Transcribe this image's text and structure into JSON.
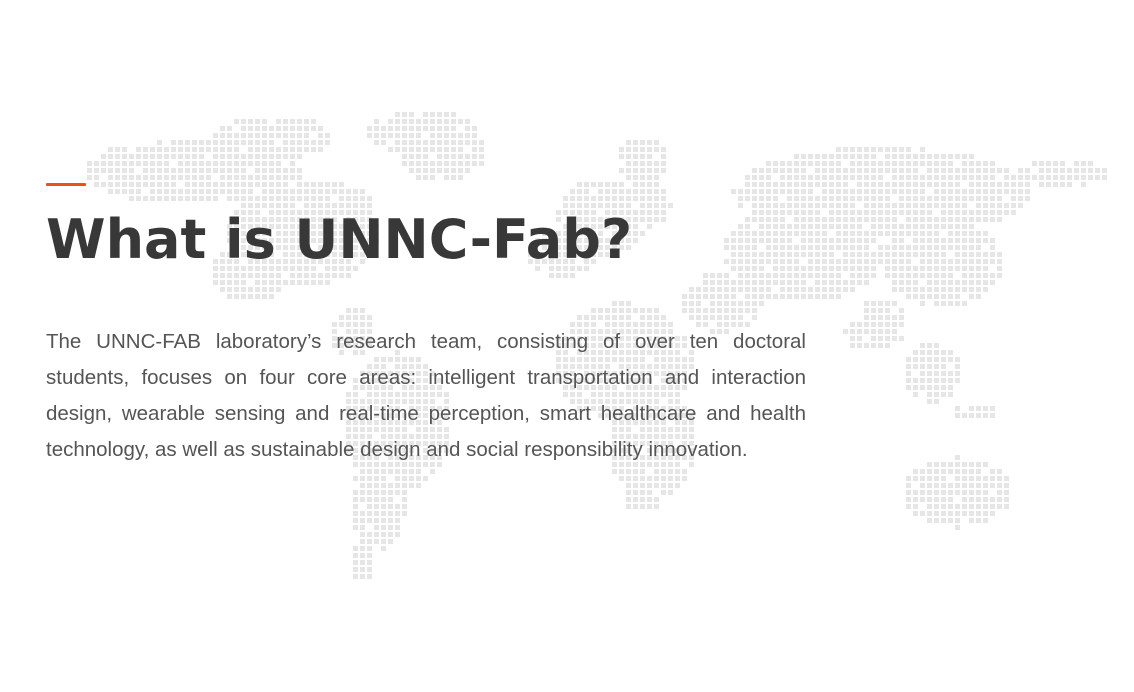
{
  "theme": {
    "accent_color": "#e8501e",
    "title_color": "#383838",
    "text_color": "#555555",
    "map_dot_color": "#e6e6e6"
  },
  "header": {
    "title": "What is UNNC-Fab?"
  },
  "main": {
    "description": "The UNNC-FAB laboratory’s research team, consisting of over ten doctoral students, focuses on four core areas: intelligent transportation and interaction design, wearable sensing and real-time perception, smart healthcare and health technology, as well as sustainable design and social responsibility innovation."
  }
}
